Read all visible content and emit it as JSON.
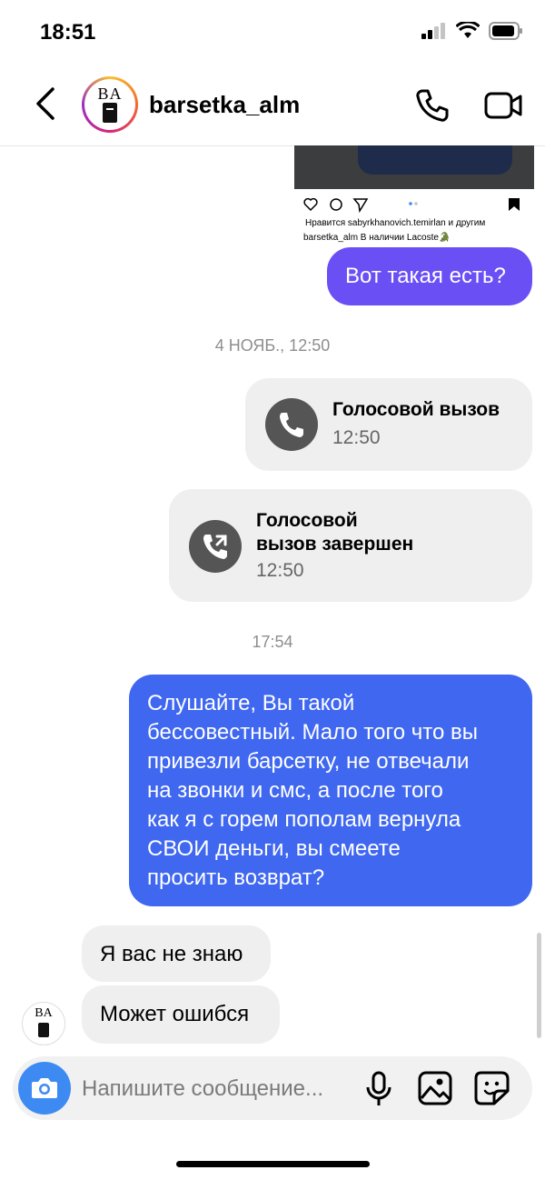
{
  "status_bar": {
    "time": "18:51"
  },
  "header": {
    "username": "barsetka_alm",
    "avatar_text": "BA"
  },
  "post": {
    "likes_text": "Нравится sabyrkhanovich.temirlan и другим",
    "caption": "barsetka_alm В наличии Lacoste🐊"
  },
  "messages": {
    "first_out": "Вот такая есть?",
    "timestamp_1": "4 НОЯБ., 12:50",
    "call_1": {
      "title": "Голосовой вызов",
      "time": "12:50"
    },
    "call_2": {
      "title_line1": "Голосовой",
      "title_line2": "вызов завершен",
      "time": "12:50"
    },
    "timestamp_2": "17:54",
    "long_out": [
      "Слушайте, Вы такой",
      "бессовестный. Мало того что вы",
      "привезли барсетку, не отвечали",
      "на звонки и смс, а после того",
      "как я с горем пополам вернула",
      "СВОИ деньги, вы смеете",
      "просить возврат?"
    ],
    "in_1": "Я вас не знаю",
    "in_2": "Может ошибся"
  },
  "composer": {
    "placeholder": "Напишите сообщение..."
  },
  "colors": {
    "out_purple": "#6a4ff5",
    "out_blue": "#3f67f0",
    "camera": "#3d8bf2"
  }
}
